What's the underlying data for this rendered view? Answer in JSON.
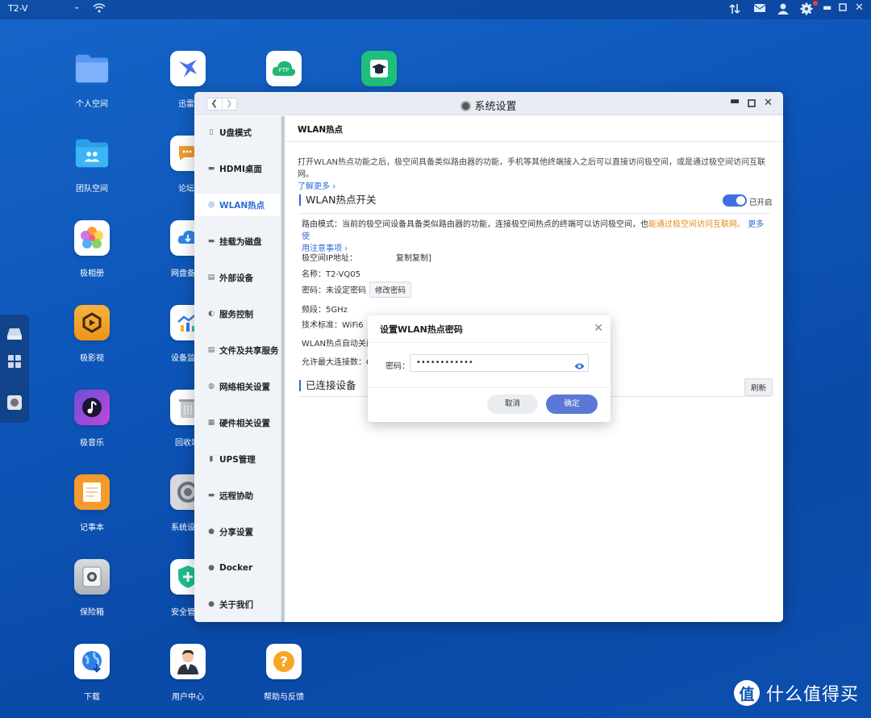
{
  "topbar": {
    "device": "T2-V",
    "icons": [
      "wifi-icon",
      "swap-icon",
      "mail-icon",
      "user-icon",
      "settings-icon",
      "minimize-icon",
      "maximize-icon",
      "close-icon"
    ]
  },
  "desktop": {
    "col1": [
      "个人空间",
      "团队空间",
      "极相册",
      "极影视",
      "极音乐",
      "记事本",
      "保险箱",
      "下载"
    ],
    "col2": [
      "迅雷",
      "论坛",
      "网盘备",
      "设备监",
      "回收站",
      "系统设",
      "安全管",
      "用户中心"
    ],
    "col3_ftp_label": "FTP",
    "help_label": "帮助与反馈"
  },
  "window": {
    "title": "系统设置",
    "sidebar": [
      {
        "label": "U盘模式",
        "icon": "usb-icon"
      },
      {
        "label": "HDMI桌面",
        "icon": "monitor-icon"
      },
      {
        "label": "WLAN热点",
        "icon": "hotspot-icon"
      },
      {
        "label": "挂载为磁盘",
        "icon": "disk-icon"
      },
      {
        "label": "外部设备",
        "icon": "device-icon"
      },
      {
        "label": "服务控制",
        "icon": "toggle-icon"
      },
      {
        "label": "文件及共享服务",
        "icon": "file-icon"
      },
      {
        "label": "网络相关设置",
        "icon": "globe-icon"
      },
      {
        "label": "硬件相关设置",
        "icon": "grid-icon"
      },
      {
        "label": "UPS管理",
        "icon": "battery-icon"
      },
      {
        "label": "远程协助",
        "icon": "remote-icon"
      },
      {
        "label": "分享设置",
        "icon": "share-icon"
      },
      {
        "label": "Docker",
        "icon": "docker-icon"
      },
      {
        "label": "关于我们",
        "icon": "info-icon"
      }
    ],
    "active_item": "WLAN热点",
    "content": {
      "header": "WLAN热点",
      "description": "打开WLAN热点功能之后，极空间具备类似路由器的功能，手机等其他终端接入之后可以直接访问极空间，或是通过极空间访问互联网。",
      "learn_more": "了解更多 ›",
      "switch_section": "WLAN热点开关",
      "switch_state": "已开启",
      "router_mode_prefix": "路由模式：当前的极空间设备具备类似路由器的功能，连接极空间热点的终端可以访问极空间，也",
      "router_mode_highlight": "能通过极空间访问互联网。",
      "router_more": "更多使",
      "router_more2": "用注意事项 ›",
      "ip_label": "极空间IP地址：",
      "copy_link": "复制复制]",
      "name_row": "名称：T2-VQ05",
      "password_row": "密码：未设定密码",
      "change_password": "修改密码",
      "band_row": "频段：5GHz",
      "standard_row": "技术标准：WiFi6",
      "auto_off_row": "WLAN热点自动关闭",
      "max_conn_row": "允许最大连接数：C",
      "connected_section": "已连接设备",
      "refresh": "刷新"
    }
  },
  "dialog": {
    "title": "设置WLAN热点密码",
    "field_label": "密码：",
    "field_value": "••••••••••••",
    "cancel": "取消",
    "ok": "确定"
  },
  "watermark": {
    "logo": "值",
    "text": "什么值得买"
  },
  "colors": {
    "accent": "#2e6cd6",
    "highlight": "#e98a16",
    "primary_button": "#5a79d6"
  }
}
